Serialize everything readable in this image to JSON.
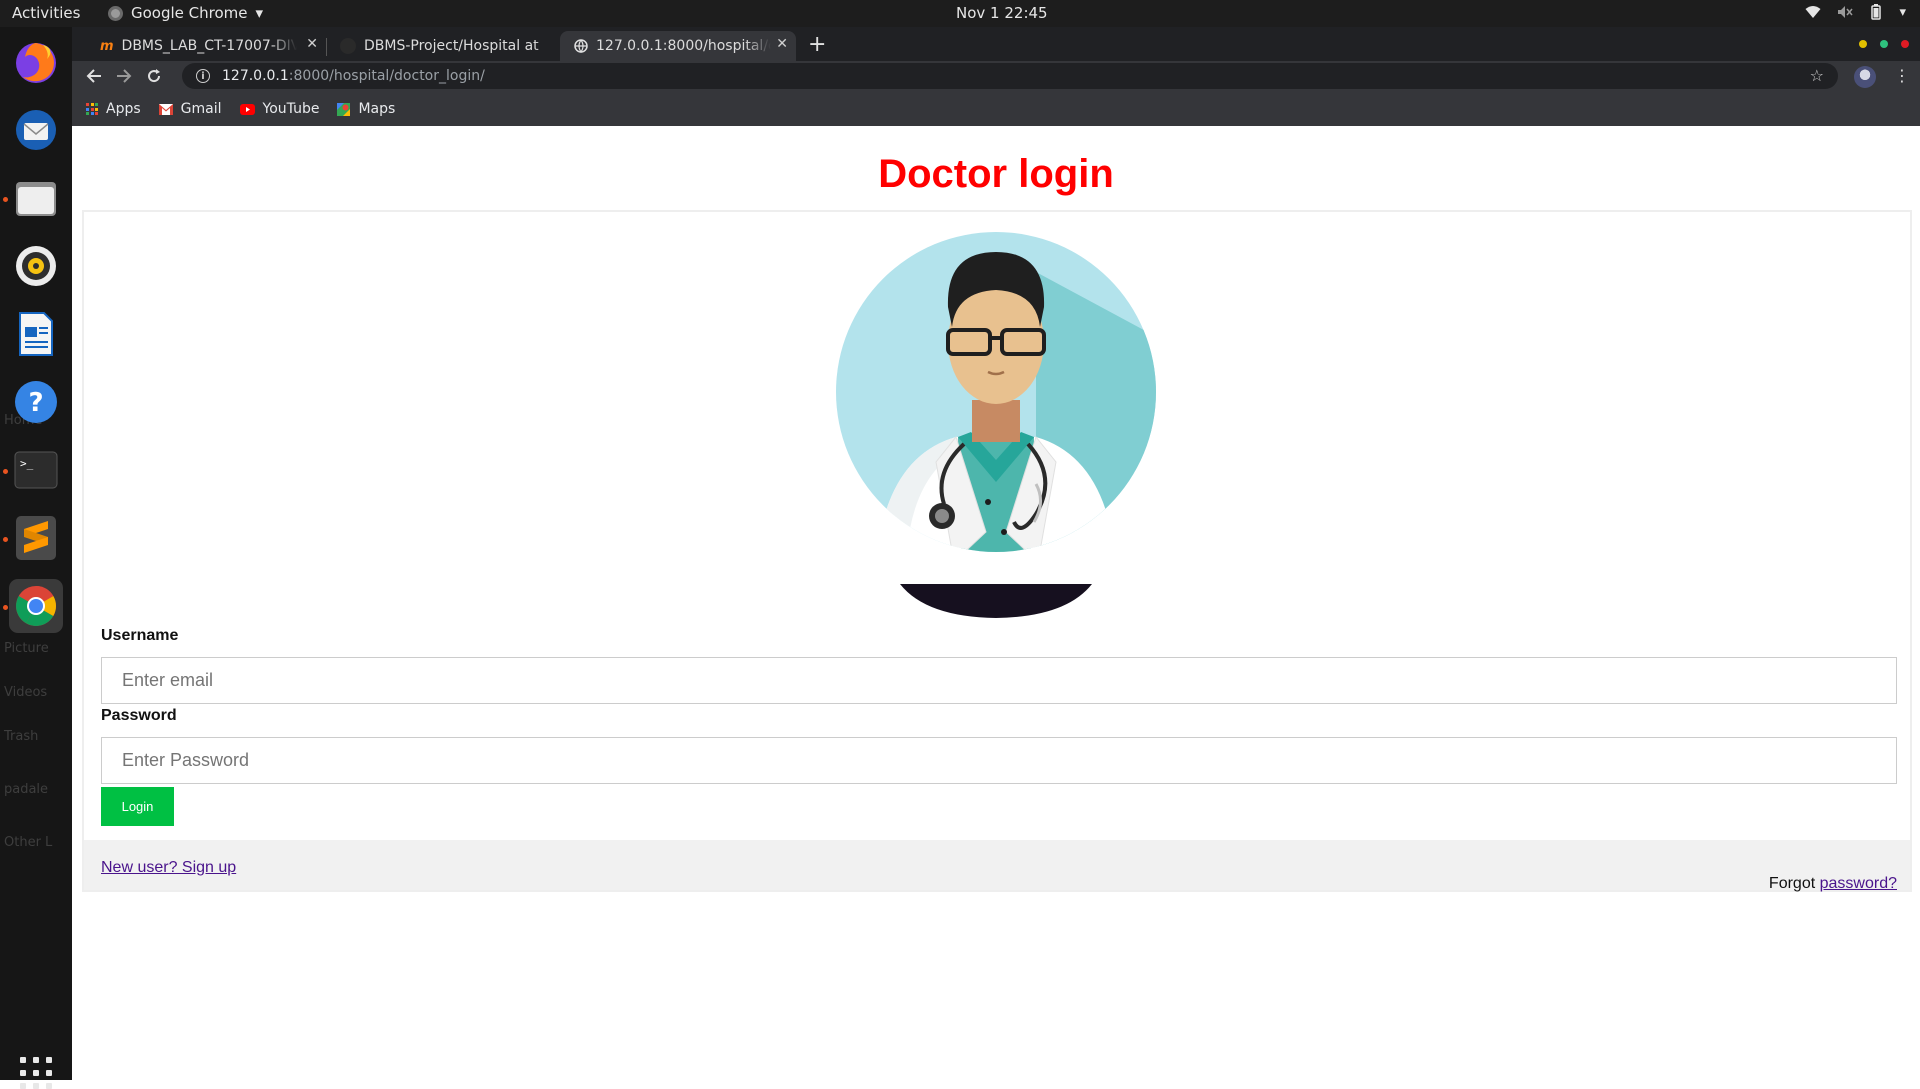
{
  "system": {
    "activities": "Activities",
    "app_menu": "Google Chrome",
    "clock": "Nov 1  22:45"
  },
  "dock": {
    "ghost_labels": [
      "Home",
      "Picture",
      "Videos",
      "Trash",
      "padale",
      "Other L"
    ]
  },
  "tabs": [
    {
      "title": "DBMS_LAB_CT-17007-DIV",
      "active": false
    },
    {
      "title": "DBMS-Project/Hospital at",
      "active": false
    },
    {
      "title": "127.0.0.1:8000/hospital/d",
      "active": true
    }
  ],
  "omnibox": {
    "host": "127.0.0.1",
    "path": ":8000/hospital/doctor_login/"
  },
  "bookmarks": [
    {
      "label": "Apps",
      "icon": "apps-grid-icon"
    },
    {
      "label": "Gmail",
      "icon": "gmail-icon"
    },
    {
      "label": "YouTube",
      "icon": "youtube-icon"
    },
    {
      "label": "Maps",
      "icon": "maps-icon"
    }
  ],
  "page": {
    "title": "Doctor login",
    "username_label": "Username",
    "username_placeholder": "Enter email",
    "password_label": "Password",
    "password_placeholder": "Enter Password",
    "login_button": "Login",
    "signup_link": "New user? Sign up",
    "forgot_text": "Forgot",
    "forgot_link": "password?"
  },
  "colors": {
    "title": "#ff0000",
    "login_button": "#00c043",
    "link": "#4a148c",
    "footer_bg": "#f1f1f1"
  }
}
